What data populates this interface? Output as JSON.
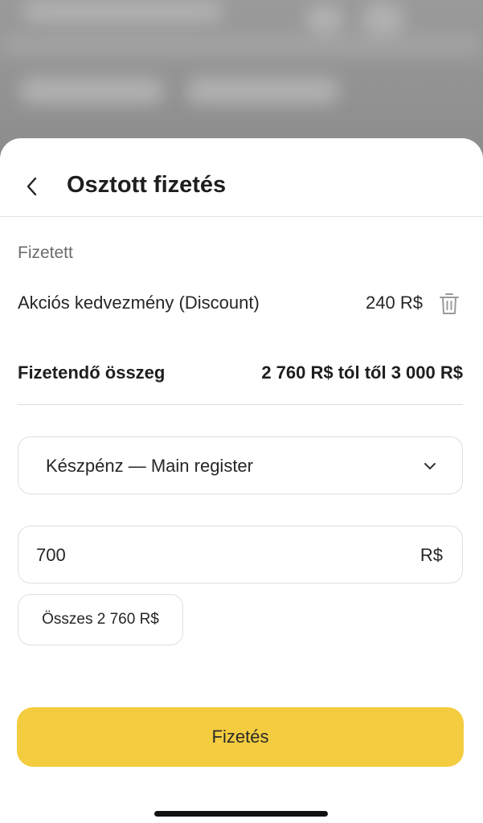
{
  "sheet": {
    "title": "Osztott fizetés"
  },
  "paid": {
    "section_label": "Fizetett",
    "discount_name": "Akciós kedvezmény (Discount)",
    "discount_amount": "240 R$"
  },
  "payable": {
    "label": "Fizetendő összeg",
    "value": "2 760 R$ tól től 3 000 R$"
  },
  "payment_method": {
    "selected": "Készpénz — Main register"
  },
  "amount": {
    "value": "700",
    "currency": "R$"
  },
  "total_chip": {
    "label": "Összes 2 760 R$"
  },
  "pay_button": {
    "label": "Fizetés"
  },
  "colors": {
    "accent": "#f4cc3f"
  },
  "icons": {
    "back": "chevron-left-icon",
    "delete": "trash-icon",
    "dropdown": "chevron-down-icon"
  }
}
